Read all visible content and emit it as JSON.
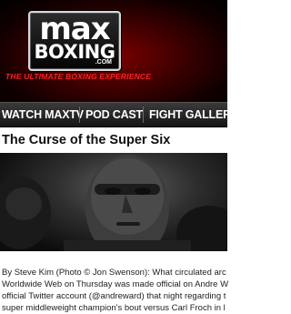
{
  "logo": {
    "line1": "max",
    "line2": "BOXING",
    "suffix": ".COM"
  },
  "tagline": "THE ULTIMATE BOXING EXPERIENCE",
  "nav": [
    {
      "label": "WATCH MAXTV"
    },
    {
      "label": "POD CAST"
    },
    {
      "label": "FIGHT GALLERIES"
    }
  ],
  "article": {
    "title": "The Curse of the Super Six",
    "photo_alt": "boxer portrait",
    "body_lines": [
      "By Steve Kim (Photo © Jon Swenson): What circulated arc",
      "Worldwide Web on Thursday was made official on Andre W",
      "official Twitter account (@andreward) that night regarding t",
      "super middleweight champion's bout versus Carl Froch in l"
    ]
  }
}
